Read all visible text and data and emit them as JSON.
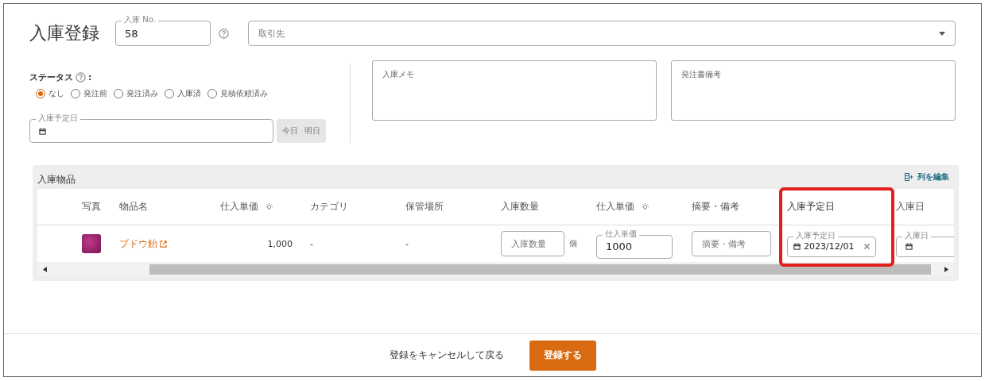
{
  "title": "入庫登録",
  "entry_no": {
    "label": "入庫 No.",
    "value": "58"
  },
  "supplier": {
    "placeholder": "取引先"
  },
  "status": {
    "label": "ステータス",
    "separator": ":",
    "options": [
      {
        "label": "なし",
        "selected": true
      },
      {
        "label": "発注前",
        "selected": false
      },
      {
        "label": "発注済み",
        "selected": false
      },
      {
        "label": "入庫済",
        "selected": false
      },
      {
        "label": "見積依頼済み",
        "selected": false
      }
    ]
  },
  "scheduled_date": {
    "label": "入庫予定日",
    "buttons": [
      "今日",
      "明日"
    ]
  },
  "memos": [
    {
      "placeholder": "入庫メモ"
    },
    {
      "placeholder": "発注書備考"
    }
  ],
  "items": {
    "title": "入庫物品",
    "edit_columns": "列を編集",
    "columns": [
      {
        "label": "写真",
        "hint": false,
        "highlighted": false
      },
      {
        "label": "物品名",
        "hint": false,
        "highlighted": false
      },
      {
        "label": "仕入単価",
        "hint": true,
        "highlighted": false
      },
      {
        "label": "カテゴリ",
        "hint": false,
        "highlighted": false
      },
      {
        "label": "保管場所",
        "hint": false,
        "highlighted": false
      },
      {
        "label": "入庫数量",
        "hint": false,
        "highlighted": false
      },
      {
        "label": "仕入単価",
        "hint": true,
        "highlighted": false
      },
      {
        "label": "摘要・備考",
        "hint": false,
        "highlighted": false
      },
      {
        "label": "入庫予定日",
        "hint": false,
        "highlighted": true
      },
      {
        "label": "入庫日",
        "hint": false,
        "highlighted": false
      }
    ],
    "rows": [
      {
        "name": "ブドウ飴",
        "price": "1,000",
        "category": "-",
        "storage": "-",
        "qty_placeholder": "入庫数量",
        "unit": "個",
        "unit_price_label": "仕入単価",
        "unit_price": "1000",
        "memo_placeholder": "摘要・備考",
        "date_label": "入庫予定日",
        "date": "2023/12/01",
        "receipt_label": "入庫日"
      }
    ]
  },
  "footer": {
    "cancel": "登録をキャンセルして戻る",
    "submit": "登録する"
  }
}
